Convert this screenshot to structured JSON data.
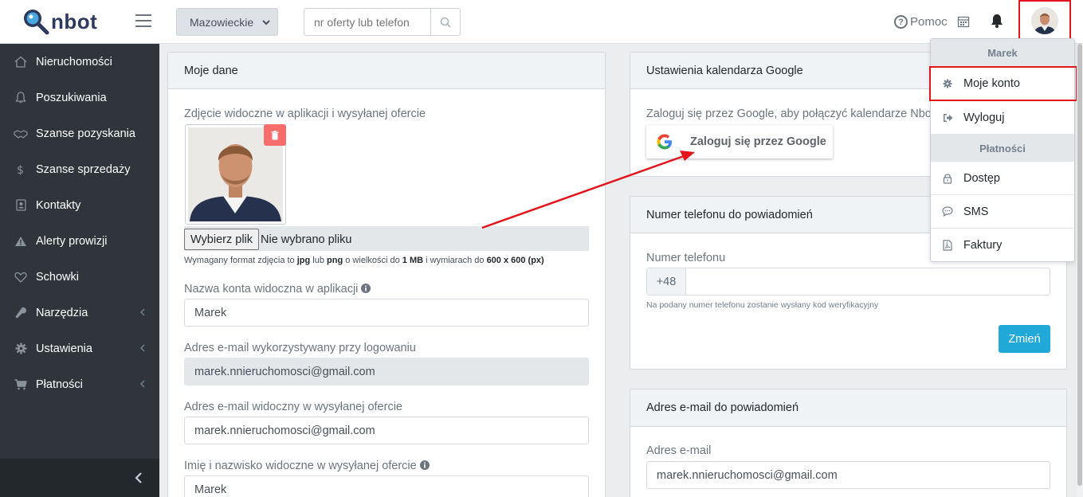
{
  "brand": {
    "logo_text": "nbot"
  },
  "topbar": {
    "region_value": "Mazowieckie",
    "search_placeholder": "nr oferty lub telefon",
    "help_label": "Pomoc"
  },
  "sidebar": {
    "items": [
      {
        "label": "Nieruchomości",
        "icon": "home-icon"
      },
      {
        "label": "Poszukiwania",
        "icon": "bell-icon"
      },
      {
        "label": "Szanse pozyskania",
        "icon": "handshake-icon"
      },
      {
        "label": "Szanse sprzedaży",
        "icon": "dollar-icon"
      },
      {
        "label": "Kontakty",
        "icon": "contact-card-icon"
      },
      {
        "label": "Alerty prowizji",
        "icon": "warning-icon"
      },
      {
        "label": "Schowki",
        "icon": "heart-icon"
      },
      {
        "label": "Narzędzia",
        "icon": "wrench-icon"
      },
      {
        "label": "Ustawienia",
        "icon": "gear-icon"
      },
      {
        "label": "Płatności",
        "icon": "cart-icon"
      }
    ]
  },
  "my_data": {
    "title": "Moje dane",
    "photo_label": "Zdjęcie widoczne w aplikacji i wysyłanej ofercie",
    "choose_file_label": "Wybierz plik",
    "no_file_label": "Nie wybrano pliku",
    "photo_help": {
      "t1": "Wymagany format zdjęcia to ",
      "b1": "jpg",
      "t2": " lub ",
      "b2": "png",
      "t3": " o wielkości do ",
      "b3": "1 MB",
      "t4": " i wymiarach do ",
      "b4": "600 x 600 (px)"
    },
    "account_name_label": "Nazwa konta widoczna w aplikacji",
    "account_name_value": "Marek",
    "login_email_label": "Adres e-mail wykorzystywany przy logowaniu",
    "login_email_value": "marek.nnieruchomosci@gmail.com",
    "offer_email_label": "Adres e-mail widoczny w wysyłanej ofercie",
    "offer_email_value": "marek.nnieruchomosci@gmail.com",
    "fullname_label": "Imię i nazwisko widoczne w wysyłanej ofercie",
    "fullname_value": "Marek"
  },
  "google_calendar": {
    "title": "Ustawienia kalendarza Google",
    "description": "Zaloguj się przez Google, aby połączyć kalendarze Nbot i",
    "button_label": "Zaloguj się przez Google"
  },
  "phone_notifications": {
    "title": "Numer telefonu do powiadomień",
    "field_label": "Numer telefonu",
    "prefix": "+48",
    "help": "Na podany numer telefonu zostanie wysłany kod weryfikacyjny",
    "change_label": "Zmień"
  },
  "email_notifications": {
    "title": "Adres e-mail do powiadomień",
    "field_label": "Adres e-mail",
    "value": "marek.nnieruchomosci@gmail.com"
  },
  "user_menu": {
    "user_header": "Marek",
    "my_account": "Moje konto",
    "logout": "Wyloguj",
    "payments_header": "Płatności",
    "access": "Dostęp",
    "sms": "SMS",
    "invoices": "Faktury"
  },
  "colors": {
    "sidebar_bg": "#2f353a",
    "accent": "#20a8d8",
    "delete": "#f86c6b",
    "highlight": "#e3141b"
  }
}
